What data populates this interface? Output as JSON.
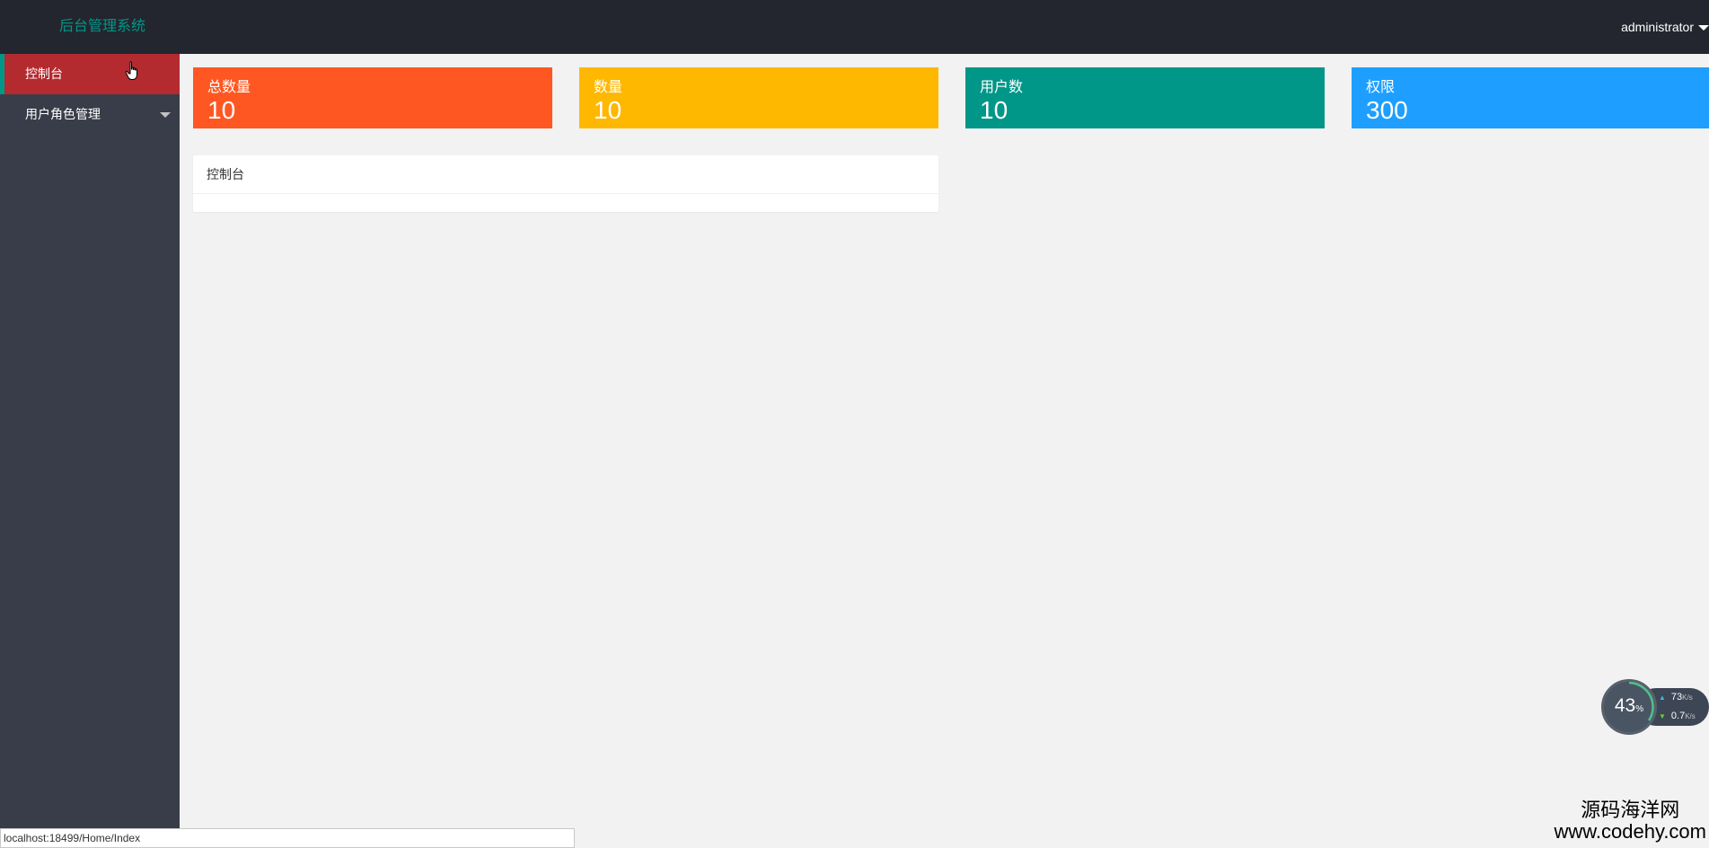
{
  "header": {
    "logo_text": "后台管理系统",
    "username": "administrator"
  },
  "sidebar": {
    "items": [
      {
        "label": "控制台",
        "active": true
      },
      {
        "label": "用户角色管理",
        "has_submenu": true
      }
    ]
  },
  "cards": [
    {
      "title": "总数量",
      "value": "10",
      "color": "#ff5722"
    },
    {
      "title": "数量",
      "value": "10",
      "color": "#ffb800"
    },
    {
      "title": "用户数",
      "value": "10",
      "color": "#009688"
    },
    {
      "title": "权限",
      "value": "300",
      "color": "#1e9fff"
    }
  ],
  "panel": {
    "title": "控制台"
  },
  "network_widget": {
    "percent": "43",
    "percent_sign": "%",
    "upload": "73",
    "download": "0.7",
    "unit": "K/s"
  },
  "watermark": {
    "site_name": "源码海洋网",
    "url": "www.codehy.com"
  },
  "status_bar": {
    "url": "localhost:18499/Home/Index"
  },
  "colors": {
    "header_bg": "#23262e",
    "sidebar_bg": "#393d49",
    "active_item_bg": "#b32a2f",
    "accent": "#009688"
  }
}
